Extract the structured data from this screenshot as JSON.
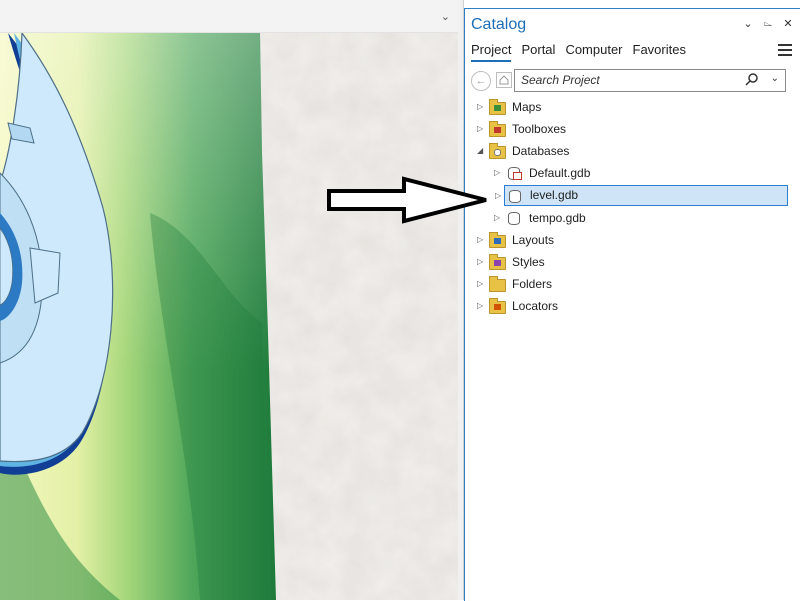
{
  "map": {
    "colors": {
      "river_light": "#cfe9fb",
      "river_mid": "#64b8e6",
      "river_dark": "#1c4fa0",
      "elevation_low": "#1e7f3a",
      "elevation_mid": "#8cc863",
      "elevation_high": "#f2f7b4",
      "hillshade": "#f4f2ef"
    }
  },
  "catalog": {
    "title": "Catalog",
    "tabs": [
      "Project",
      "Portal",
      "Computer",
      "Favorites"
    ],
    "active_tab": "Project",
    "search_placeholder": "Search Project",
    "tree": {
      "maps": "Maps",
      "toolboxes": "Toolboxes",
      "databases": "Databases",
      "default_gdb": "Default.gdb",
      "level_gdb": "level.gdb",
      "tempo_gdb": "tempo.gdb",
      "layouts": "Layouts",
      "styles": "Styles",
      "folders": "Folders",
      "locators": "Locators"
    }
  },
  "colors": {
    "accent": "#1d6fb8",
    "selection": "#cfe4f6"
  }
}
